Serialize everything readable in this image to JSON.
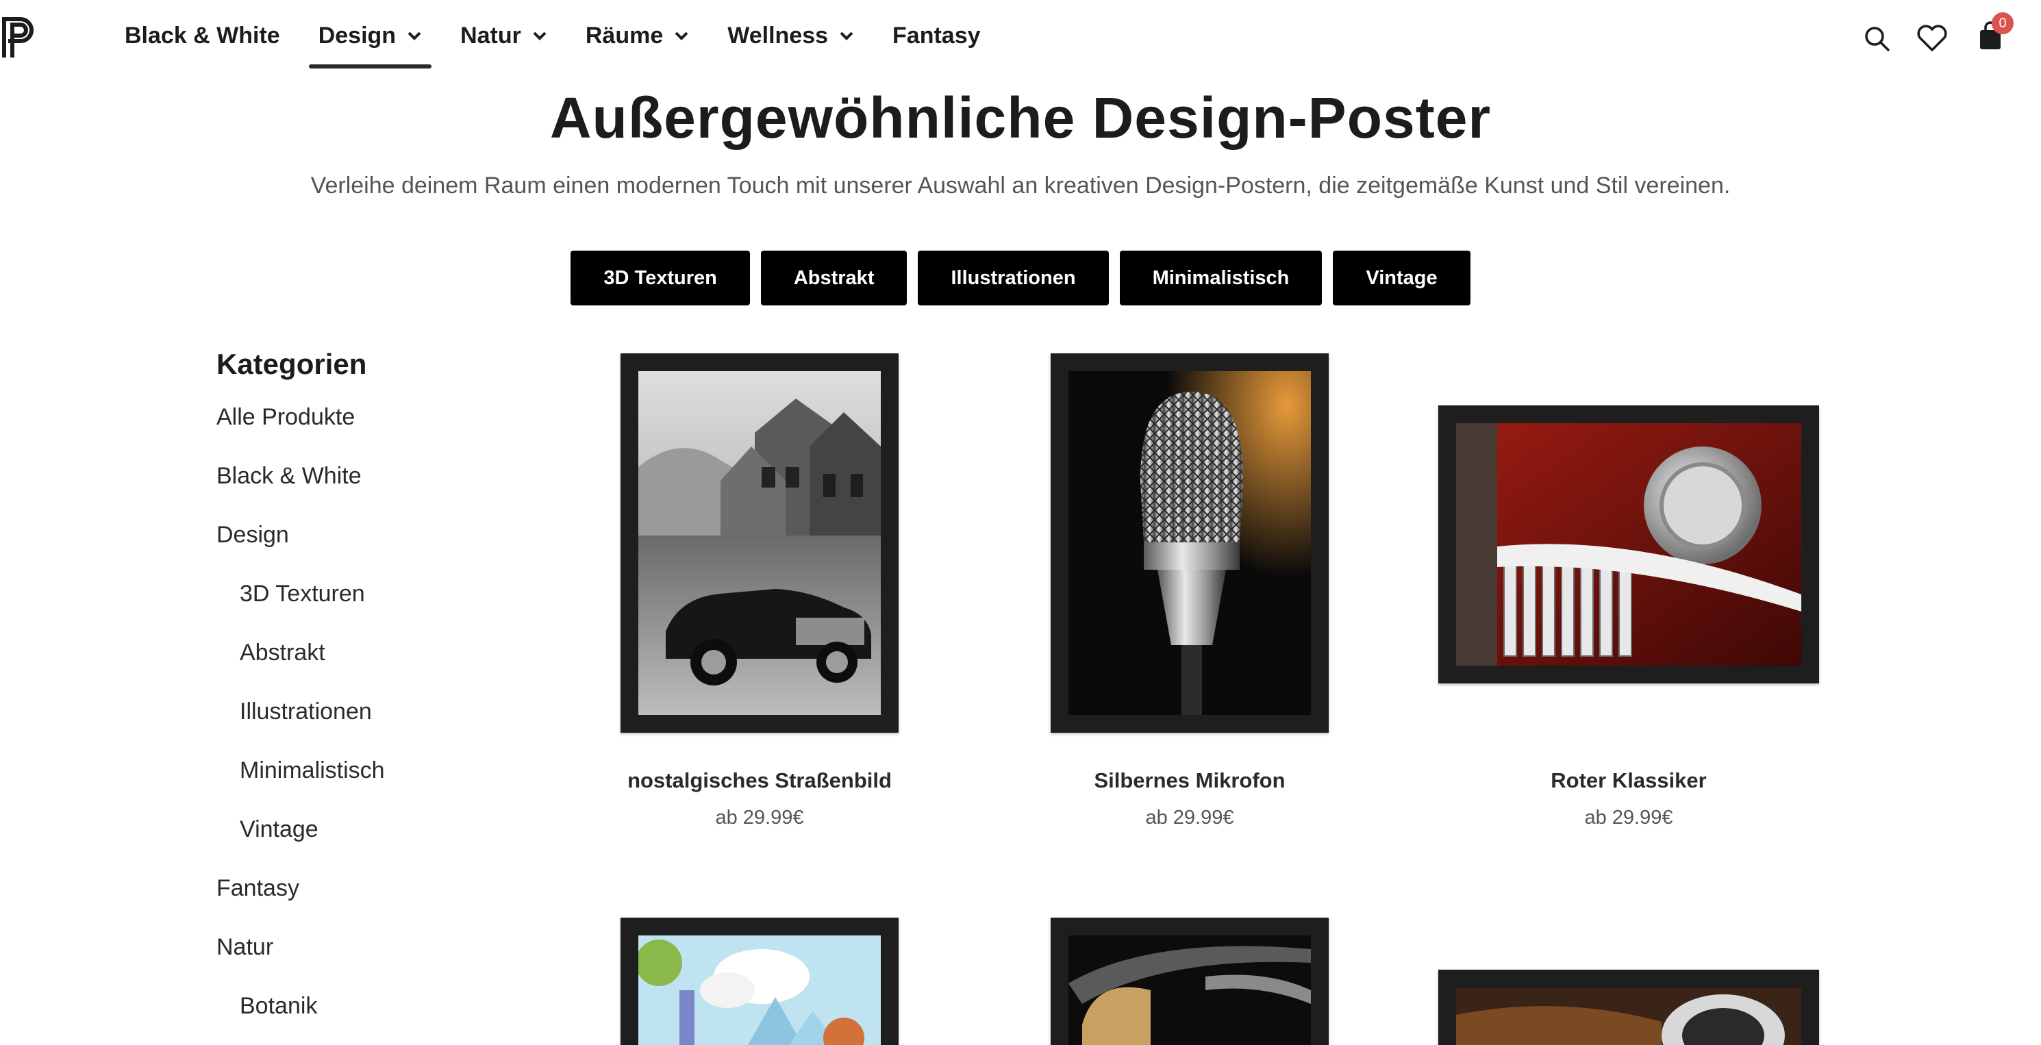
{
  "header": {
    "nav": [
      {
        "label": "Black & White",
        "dropdown": false,
        "active": false
      },
      {
        "label": "Design",
        "dropdown": true,
        "active": true
      },
      {
        "label": "Natur",
        "dropdown": true,
        "active": false
      },
      {
        "label": "Räume",
        "dropdown": true,
        "active": false
      },
      {
        "label": "Wellness",
        "dropdown": true,
        "active": false
      },
      {
        "label": "Fantasy",
        "dropdown": false,
        "active": false
      }
    ],
    "icons": [
      "search-icon",
      "heart-icon",
      "shopping-bag-icon"
    ],
    "cart_count": "0"
  },
  "hero": {
    "title": "Außergewöhnliche Design-Poster",
    "subtitle": "Verleihe deinem Raum einen modernen Touch mit unserer Auswahl an kreativen Design-Postern, die zeitgemäße Kunst und Stil vereinen."
  },
  "chips": [
    "3D Texturen",
    "Abstrakt",
    "Illustrationen",
    "Minimalistisch",
    "Vintage"
  ],
  "sidebar": {
    "heading": "Kategorien",
    "items": [
      {
        "label": "Alle Produkte",
        "sub": false
      },
      {
        "label": "Black & White",
        "sub": false
      },
      {
        "label": "Design",
        "sub": false
      },
      {
        "label": "3D Texturen",
        "sub": true
      },
      {
        "label": "Abstrakt",
        "sub": true
      },
      {
        "label": "Illustrationen",
        "sub": true
      },
      {
        "label": "Minimalistisch",
        "sub": true
      },
      {
        "label": "Vintage",
        "sub": true
      },
      {
        "label": "Fantasy",
        "sub": false
      },
      {
        "label": "Natur",
        "sub": false
      },
      {
        "label": "Botanik",
        "sub": true
      }
    ]
  },
  "products": [
    {
      "title": "nostalgisches Straßenbild",
      "price": "ab 29.99€"
    },
    {
      "title": "Silbernes Mikrofon",
      "price": "ab 29.99€"
    },
    {
      "title": "Roter Klassiker",
      "price": "ab 29.99€"
    }
  ],
  "colors": {
    "text": "#1c1c1c",
    "chip_bg": "#000000",
    "frame": "#1e1e1e",
    "badge": "#d9534f"
  }
}
